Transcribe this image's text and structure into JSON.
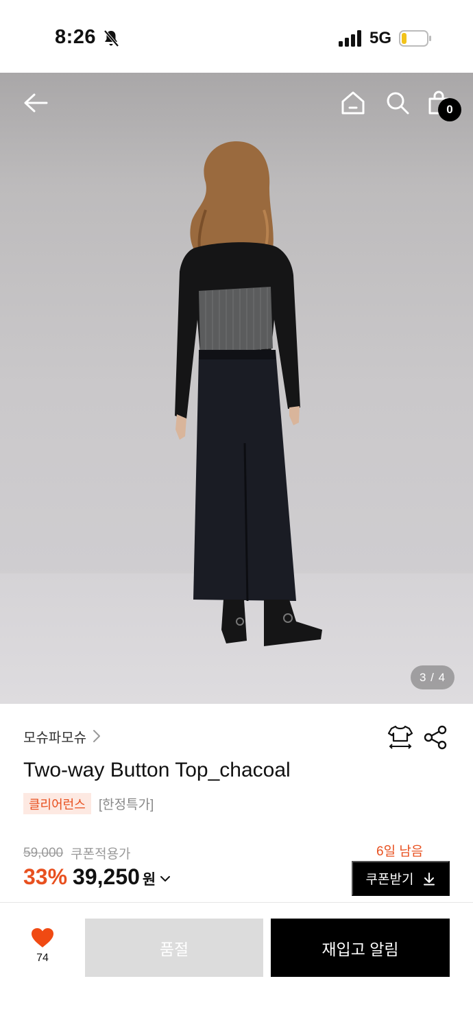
{
  "status_bar": {
    "time": "8:26",
    "network": "5G",
    "icons": [
      "bell-slash-icon",
      "signal-icon",
      "battery-icon"
    ],
    "battery_level": 0.2
  },
  "header": {
    "icons": [
      "back-arrow-icon",
      "home-icon",
      "search-icon",
      "cart-icon"
    ],
    "cart_count": "0"
  },
  "gallery": {
    "counter": "3 / 4",
    "current": 3,
    "total": 4
  },
  "product": {
    "brand": "모슈파모슈",
    "title": "Two-way Button Top_chacoal",
    "tags": {
      "clearance": "클리어런스",
      "limited": "[한정특가]"
    },
    "original_price": "59,000",
    "coupon_label": "쿠폰적용가",
    "discount_rate": "33%",
    "final_price": "39,250",
    "currency": "원",
    "days_left": "6일 남음",
    "coupon_button": "쿠폰받기"
  },
  "bottom_bar": {
    "like_count": "74",
    "soldout_label": "품절",
    "restock_label": "재입고 알림"
  },
  "colors": {
    "accent": "#e8501f",
    "tag_background": "#fde9e2",
    "primary_button": "#000000",
    "disabled_button": "#dcdcdc"
  }
}
